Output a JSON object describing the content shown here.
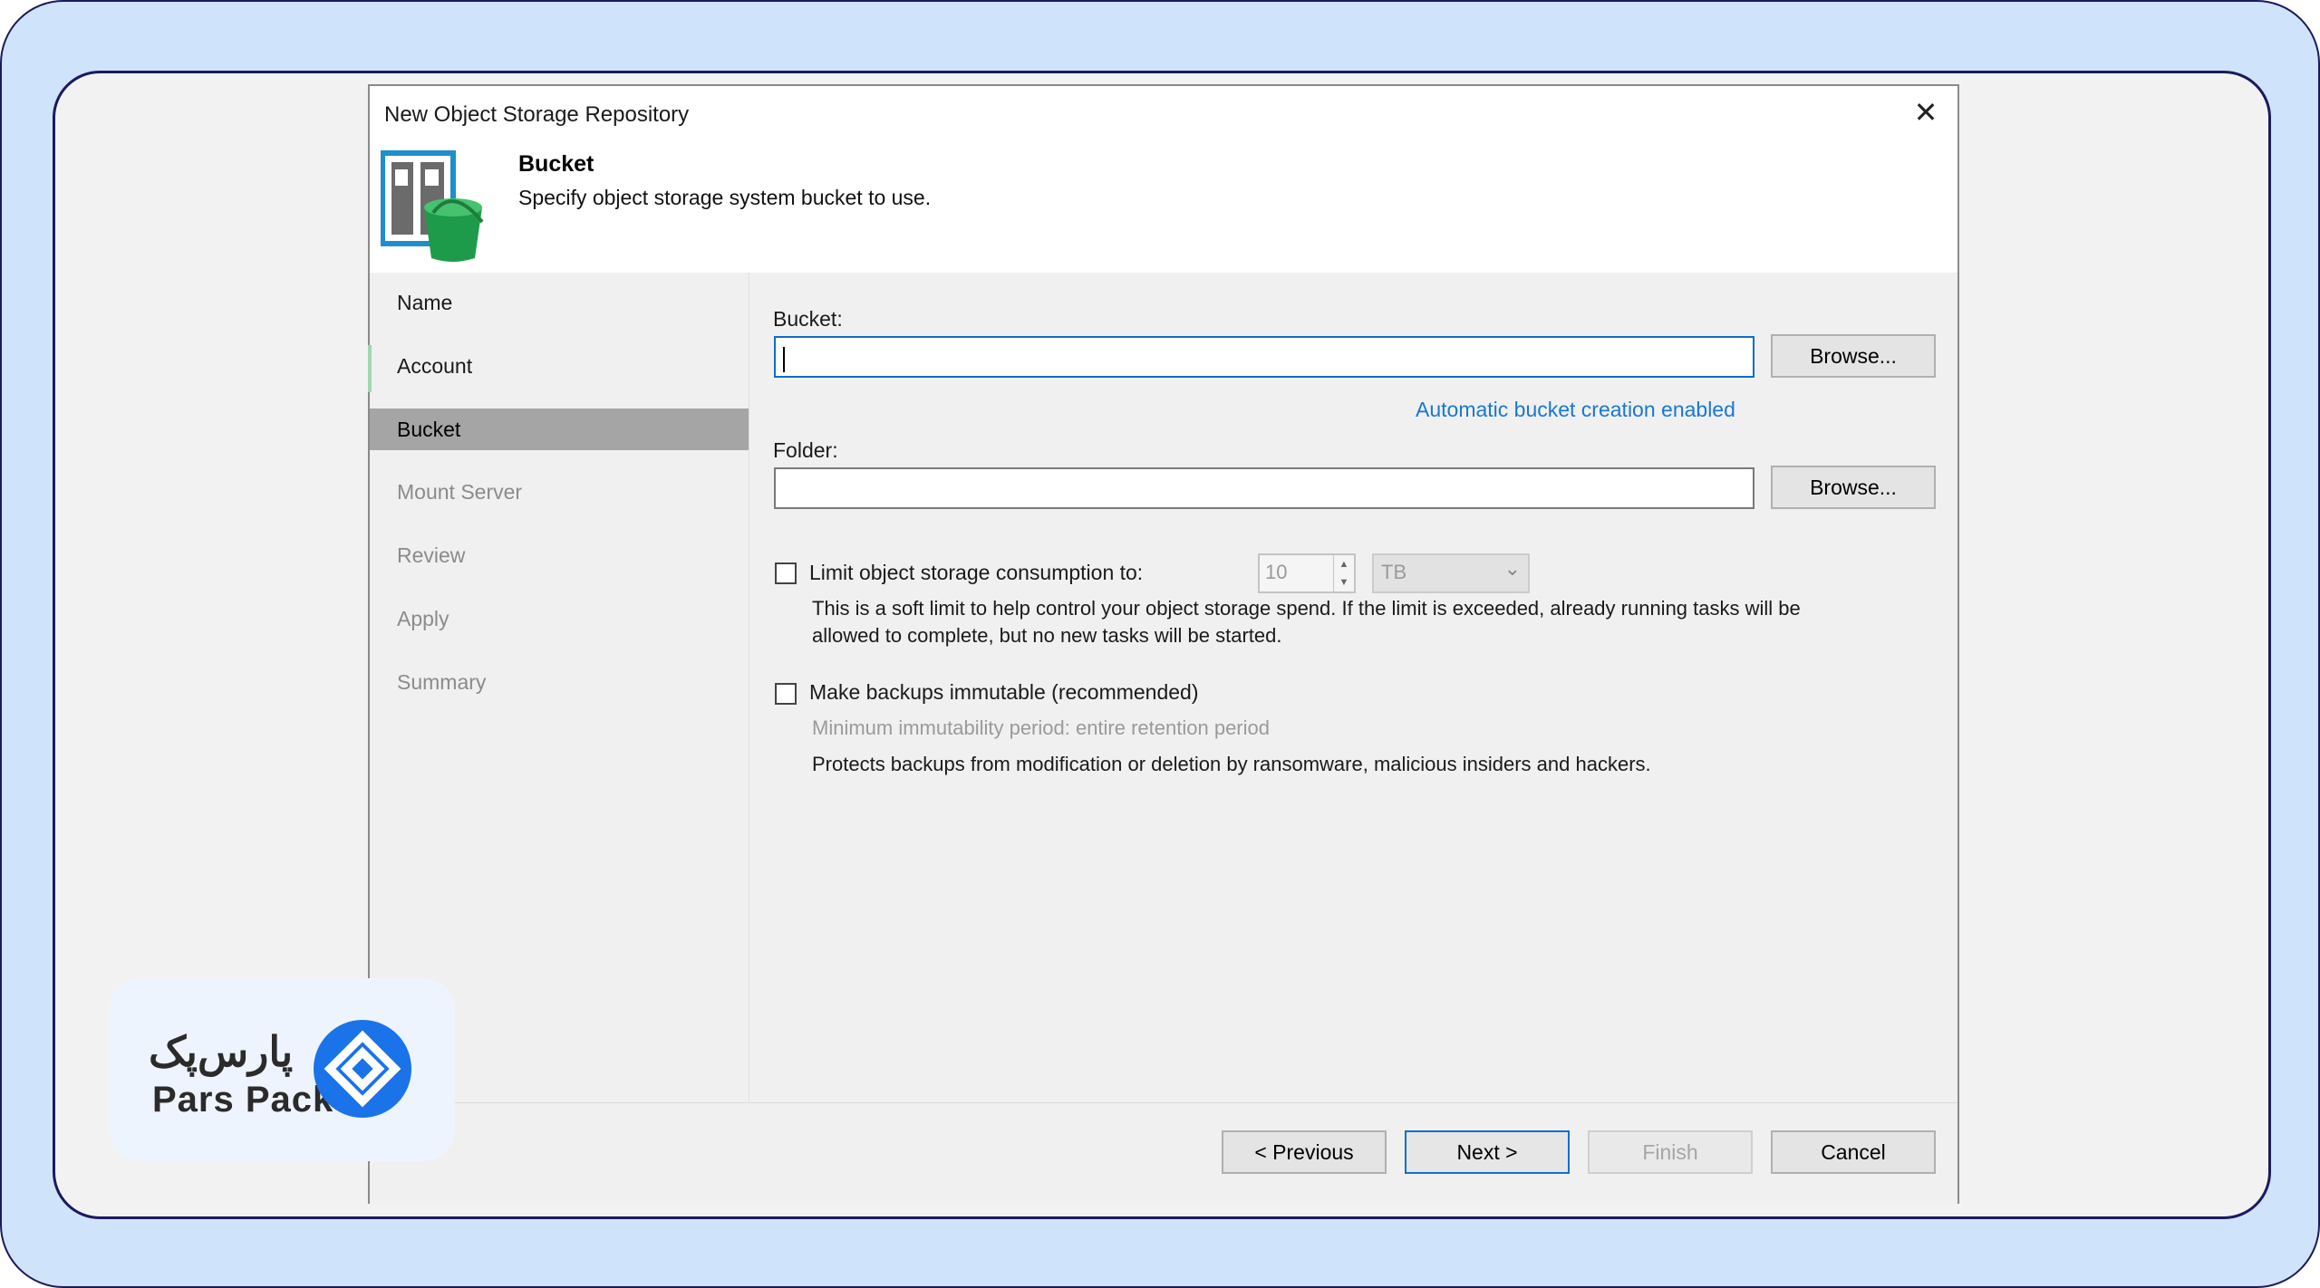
{
  "dialog": {
    "title": "New Object Storage Repository",
    "close_label": "✕"
  },
  "header": {
    "step_title": "Bucket",
    "step_description": "Specify object storage system bucket to use."
  },
  "sidebar": {
    "items": [
      {
        "label": "Name",
        "state": "enabled"
      },
      {
        "label": "Account",
        "state": "enabled"
      },
      {
        "label": "Bucket",
        "state": "active"
      },
      {
        "label": "Mount Server",
        "state": "disabled"
      },
      {
        "label": "Review",
        "state": "disabled"
      },
      {
        "label": "Apply",
        "state": "disabled"
      },
      {
        "label": "Summary",
        "state": "disabled"
      }
    ]
  },
  "bucket": {
    "label": "Bucket:",
    "value": "",
    "browse_label": "Browse...",
    "auto_link": "Automatic bucket creation enabled"
  },
  "folder": {
    "label": "Folder:",
    "value": "",
    "browse_label": "Browse..."
  },
  "limit": {
    "checked": false,
    "label": "Limit object storage consumption to:",
    "value": "10",
    "unit": "TB",
    "help_line1": "This is a soft limit to help control your object storage spend. If the limit is exceeded, already running tasks will be",
    "help_line2": "allowed to complete, but no new tasks will be started."
  },
  "immutable": {
    "checked": false,
    "label": "Make backups immutable (recommended)",
    "period_text": "Minimum immutability period: entire retention period",
    "help": "Protects backups from modification or deletion by ransomware, malicious insiders and hackers."
  },
  "footer": {
    "previous": "< Previous",
    "next": "Next >",
    "finish": "Finish",
    "cancel": "Cancel"
  },
  "logo": {
    "fa_text": "پارس‌پک",
    "en_text": "Pars Pack",
    "brand_color": "#1a73e8"
  }
}
